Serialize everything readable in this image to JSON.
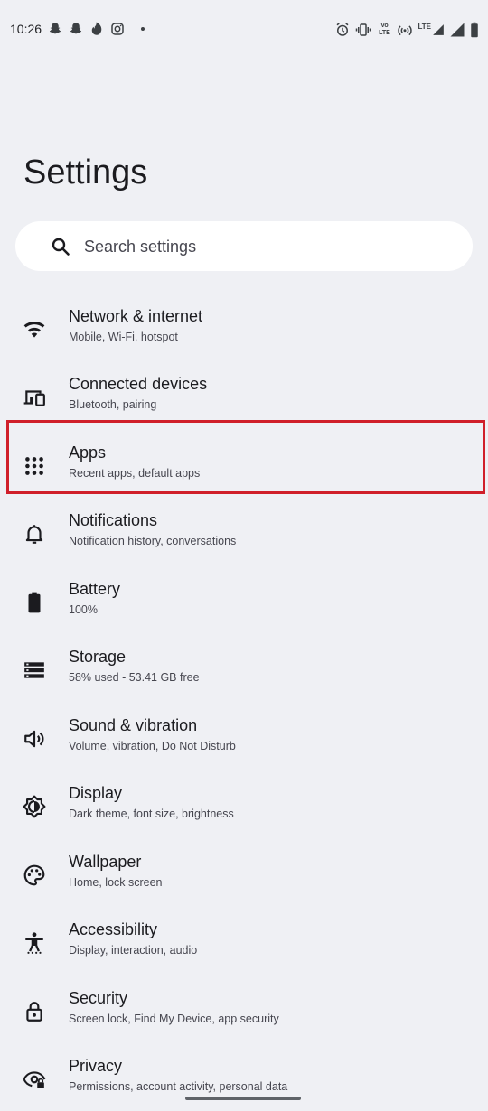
{
  "status_bar": {
    "time": "10:26",
    "left_icons": [
      "snapchat-icon",
      "snapchat-icon",
      "tinder-icon",
      "instagram-icon",
      "notification-dot"
    ],
    "right_icons": [
      "alarm-icon",
      "vibrate-icon",
      "volte-icon",
      "hotspot-icon",
      "lte-signal-icon",
      "signal-icon",
      "battery-icon"
    ],
    "lte_label": "LTE",
    "volte_label": "Vo LTE"
  },
  "page": {
    "title": "Settings"
  },
  "search": {
    "placeholder": "Search settings",
    "icon": "search-icon"
  },
  "settings_items": [
    {
      "title": "Network & internet",
      "subtitle": "Mobile, Wi-Fi, hotspot",
      "icon": "wifi-icon"
    },
    {
      "title": "Connected devices",
      "subtitle": "Bluetooth, pairing",
      "icon": "devices-icon"
    },
    {
      "title": "Apps",
      "subtitle": "Recent apps, default apps",
      "icon": "apps-grid-icon"
    },
    {
      "title": "Notifications",
      "subtitle": "Notification history, conversations",
      "icon": "bell-icon"
    },
    {
      "title": "Battery",
      "subtitle": "100%",
      "icon": "battery-icon"
    },
    {
      "title": "Storage",
      "subtitle": "58% used - 53.41 GB free",
      "icon": "storage-icon"
    },
    {
      "title": "Sound & vibration",
      "subtitle": "Volume, vibration, Do Not Disturb",
      "icon": "speaker-icon"
    },
    {
      "title": "Display",
      "subtitle": "Dark theme, font size, brightness",
      "icon": "brightness-icon"
    },
    {
      "title": "Wallpaper",
      "subtitle": "Home, lock screen",
      "icon": "palette-icon"
    },
    {
      "title": "Accessibility",
      "subtitle": "Display, interaction, audio",
      "icon": "accessibility-icon"
    },
    {
      "title": "Security",
      "subtitle": "Screen lock, Find My Device, app security",
      "icon": "lock-icon"
    },
    {
      "title": "Privacy",
      "subtitle": "Permissions, account activity, personal data",
      "icon": "eye-icon"
    }
  ],
  "colors": {
    "background": "#eff0f4",
    "highlight_border": "#d01f2a",
    "search_bg": "#ffffff"
  }
}
